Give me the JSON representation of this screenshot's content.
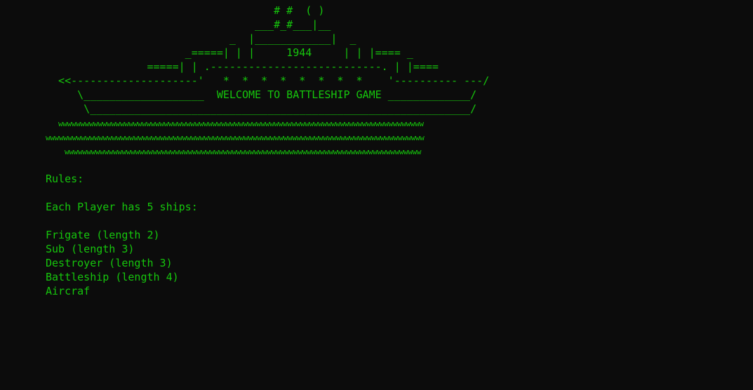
{
  "terminal": {
    "text_color": "#16c60c",
    "background": "#0c0c0c",
    "banner_lines": [
      "                                    # #  ( )",
      "                                 ___#_#___|__",
      "                             _  |____________|  _",
      "                      _=====| | |     1944     | | |==== _",
      "                =====| | .---------------------------. | |====",
      "  <<--------------------'   *  *  *  *  *  *  *  *    '---------- ---/",
      "     \\___________________  WELCOME TO BATTLESHIP GAME _____________/",
      "      \\____________________________________________________________/"
    ],
    "waves": [
      "wwwwwwwwwwwwwwwwwwwwwwwwwwwwwwwwwwwwwwwwwwwwwwwwwwwwwwwwwwwwwwwwwwwwwwwwwwwwwwwwwww",
      "wwwwwwwwwwwwwwwwwwwwwwwwwwwwwwwwwwwwwwwwwwwwwwwwwwwwwwwwwwwwwwwwwwwwwwwwwwwwwwwwwwwwww",
      "wwwwwwwwwwwwwwwwwwwwwwwwwwwwwwwwwwwwwwwwwwwwwwwwwwwwwwwwwwwwwwwwwwwwwwwwwwwwwwwww"
    ],
    "rules_heading": "Rules:",
    "ships_intro": "Each Player has 5 ships:",
    "ships": [
      "Frigate (length 2)",
      "Sub (length 3)",
      "Destroyer (length 3)",
      "Battleship (length 4)",
      "Aircraf"
    ]
  }
}
